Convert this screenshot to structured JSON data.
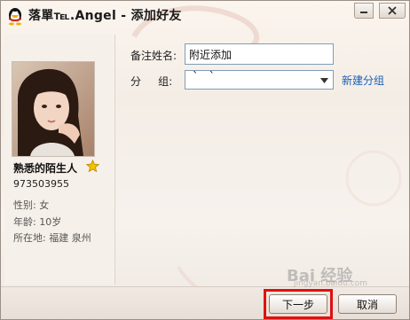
{
  "window": {
    "title": "落單℡.Angel - 添加好友"
  },
  "profile": {
    "nickname": "熟悉的陌生人",
    "qq_number": "973503955",
    "gender": "性别: 女",
    "age": "年龄: 10岁",
    "location": "所在地: 福建  泉州"
  },
  "form": {
    "remark_label": "备注姓名:",
    "remark_value": "附近添加",
    "group_label": "分     组:",
    "group_value": "` `",
    "new_group_link": "新建分组"
  },
  "buttons": {
    "next": "下一步",
    "cancel": "取消"
  },
  "watermark": {
    "text": "Bai 经验",
    "sub": "jingyan.baidu.com"
  },
  "colors": {
    "link": "#1760b8",
    "highlight": "#e01010"
  }
}
